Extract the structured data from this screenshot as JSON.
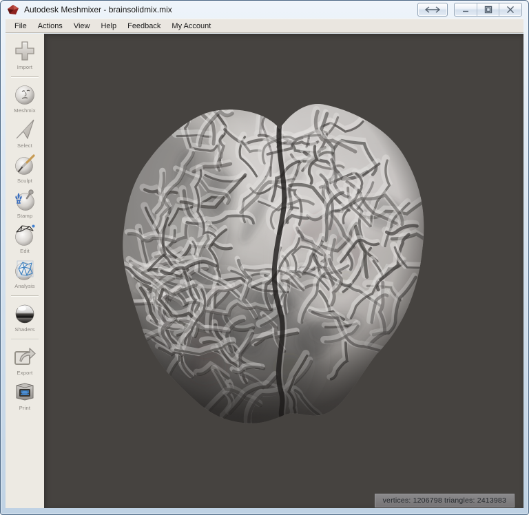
{
  "window": {
    "title": "Autodesk Meshmixer - brainsolidmix.mix",
    "controls": [
      {
        "name": "switch-view",
        "icon": "double-arrow-icon"
      },
      {
        "name": "minimize",
        "icon": "minimize-icon"
      },
      {
        "name": "maximize",
        "icon": "maximize-icon"
      },
      {
        "name": "close",
        "icon": "close-icon"
      }
    ]
  },
  "menu": {
    "items": [
      {
        "label": "File"
      },
      {
        "label": "Actions"
      },
      {
        "label": "View"
      },
      {
        "label": "Help"
      },
      {
        "label": "Feedback"
      },
      {
        "label": "My Account"
      }
    ]
  },
  "sidebar": {
    "tools": [
      {
        "label": "Import",
        "icon": "plus-icon"
      },
      {
        "label": "Meshmix",
        "icon": "face-sphere-icon"
      },
      {
        "label": "Select",
        "icon": "cursor-dart-icon"
      },
      {
        "label": "Sculpt",
        "icon": "brush-sphere-icon"
      },
      {
        "label": "Stamp",
        "icon": "fleur-stamp-icon"
      },
      {
        "label": "Edit",
        "icon": "wireframe-pen-icon"
      },
      {
        "label": "Analysis",
        "icon": "mesh-sphere-icon"
      },
      {
        "label": "Shaders",
        "icon": "chrome-sphere-icon"
      },
      {
        "label": "Export",
        "icon": "export-arrow-icon"
      },
      {
        "label": "Print",
        "icon": "printer-icon"
      }
    ],
    "separators_after": [
      "Import",
      "Analysis",
      "Shaders"
    ]
  },
  "viewport": {
    "model_name": "brain mesh",
    "status": {
      "vertices": "1206798",
      "triangles": "2413983",
      "text": "vertices: 1206798 triangles: 2413983"
    }
  },
  "colors": {
    "titlebar": "#dde8f3",
    "menubar": "#eae6e0",
    "sidebar": "#edeae3",
    "viewport_bg": "#464340",
    "status_bg": "#828082",
    "brain_base": "#b0adaa",
    "accent_blue": "#3f7fc0",
    "logo_red": "#8e2320"
  }
}
